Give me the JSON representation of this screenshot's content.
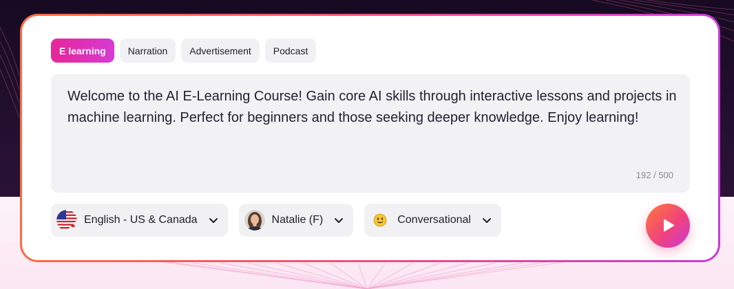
{
  "tabs": [
    {
      "label": "E learning",
      "active": true
    },
    {
      "label": "Narration",
      "active": false
    },
    {
      "label": "Advertisement",
      "active": false
    },
    {
      "label": "Podcast",
      "active": false
    }
  ],
  "editor": {
    "text": "Welcome to the AI E-Learning Course! Gain core AI skills through interactive lessons and projects in machine learning. Perfect for beginners and those seeking deeper knowledge. Enjoy learning!",
    "counter": "192 / 500"
  },
  "selectors": {
    "language": {
      "label": "English - US & Canada",
      "icon": "us-canada-flag-icon"
    },
    "voice": {
      "label": "Natalie (F)",
      "icon": "avatar"
    },
    "style": {
      "label": "Conversational",
      "icon": "smiley-emoji-icon"
    }
  },
  "play_button": {
    "icon": "play-icon"
  },
  "colors": {
    "accent_pink": "#e8269a",
    "accent_purple": "#c93ad8",
    "accent_orange": "#ff6a3d",
    "dark_background": "#170a22"
  }
}
